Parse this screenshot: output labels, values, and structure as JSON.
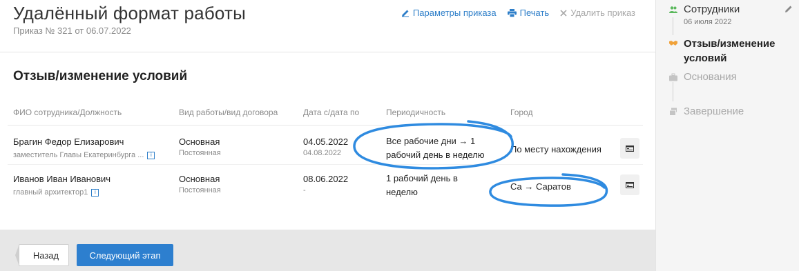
{
  "header": {
    "title": "Удалённый формат работы",
    "subtitle": "Приказ № 321 от 06.07.2022",
    "actions": {
      "params_label": "Параметры приказа",
      "print_label": "Печать",
      "delete_label": "Удалить приказ"
    }
  },
  "section": {
    "title": "Отзыв/изменение условий"
  },
  "table": {
    "columns": [
      "ФИО сотрудника/Должность",
      "Вид работы/вид договора",
      "Дата с/дата по",
      "Периодичность",
      "Город"
    ],
    "rows": [
      {
        "name": "Брагин Федор Елизарович",
        "position": "заместитель Главы Екатеринбурга ...",
        "work_type": "Основная",
        "contract_type": "Постоянная",
        "date_from": "04.05.2022",
        "date_to": "04.08.2022",
        "period": "Все рабочие дни → 1 рабочий день в неделю",
        "city": "По месту нахождения"
      },
      {
        "name": "Иванов Иван Иванович",
        "position": "главный архитектор1",
        "work_type": "Основная",
        "contract_type": "Постоянная",
        "date_from": "08.06.2022",
        "date_to": "-",
        "period": "1 рабочий день в неделю",
        "city": "Са → Саратов"
      }
    ]
  },
  "footer": {
    "back_label": "Назад",
    "next_label": "Следующий этап"
  },
  "sidebar": {
    "steps": [
      {
        "label": "Сотрудники",
        "date": "06 июля 2022",
        "state": "done",
        "icon": "users-icon"
      },
      {
        "label": "Отзыв/изменение условий",
        "state": "current",
        "icon": "handshake-icon"
      },
      {
        "label": "Основания",
        "state": "pending",
        "icon": "briefcase-icon"
      },
      {
        "label": "Завершение",
        "state": "pending",
        "icon": "stack-icon"
      }
    ]
  },
  "colors": {
    "accent": "#2d7fcf",
    "annotation": "#2f8be0",
    "step_done": "#5bb85d",
    "step_current": "#f0a23a"
  }
}
